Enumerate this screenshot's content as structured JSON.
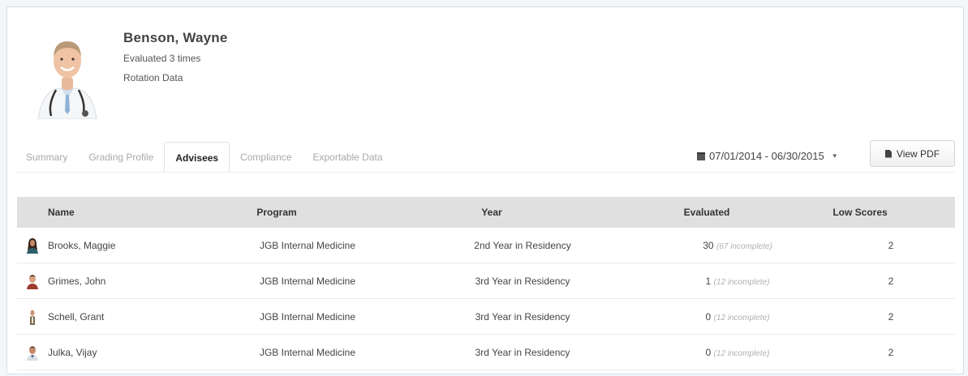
{
  "profile": {
    "name": "Benson, Wayne",
    "evaluated_text": "Evaluated 3 times",
    "rotation_text": "Rotation Data"
  },
  "tabs": [
    {
      "label": "Summary",
      "active": false
    },
    {
      "label": "Grading Profile",
      "active": false
    },
    {
      "label": "Advisees",
      "active": true
    },
    {
      "label": "Compliance",
      "active": false
    },
    {
      "label": "Exportable Data",
      "active": false
    }
  ],
  "date_range": {
    "icon": "calendar-icon",
    "label": "07/01/2014 - 06/30/2015"
  },
  "view_pdf": {
    "icon": "document-icon",
    "label": "View PDF"
  },
  "table": {
    "columns": [
      "Name",
      "Program",
      "Year",
      "Evaluated",
      "Low Scores"
    ],
    "rows": [
      {
        "name": "Brooks, Maggie",
        "program": "JGB Internal Medicine",
        "year": "2nd Year in Residency",
        "evaluated": "30",
        "incomplete": "(67 incomplete)",
        "low_scores": "2"
      },
      {
        "name": "Grimes, John",
        "program": "JGB Internal Medicine",
        "year": "3rd Year in Residency",
        "evaluated": "1",
        "incomplete": "(12 incomplete)",
        "low_scores": "2"
      },
      {
        "name": "Schell, Grant",
        "program": "JGB Internal Medicine",
        "year": "3rd Year in Residency",
        "evaluated": "0",
        "incomplete": "(12 incomplete)",
        "low_scores": "2"
      },
      {
        "name": "Julka, Vijay",
        "program": "JGB Internal Medicine",
        "year": "3rd Year in Residency",
        "evaluated": "0",
        "incomplete": "(12 incomplete)",
        "low_scores": "2"
      }
    ]
  },
  "colors": {
    "header_bg": "#e0e0e0",
    "tab_inactive": "#a9a9a9",
    "incomplete_text": "#b0b0b0"
  }
}
